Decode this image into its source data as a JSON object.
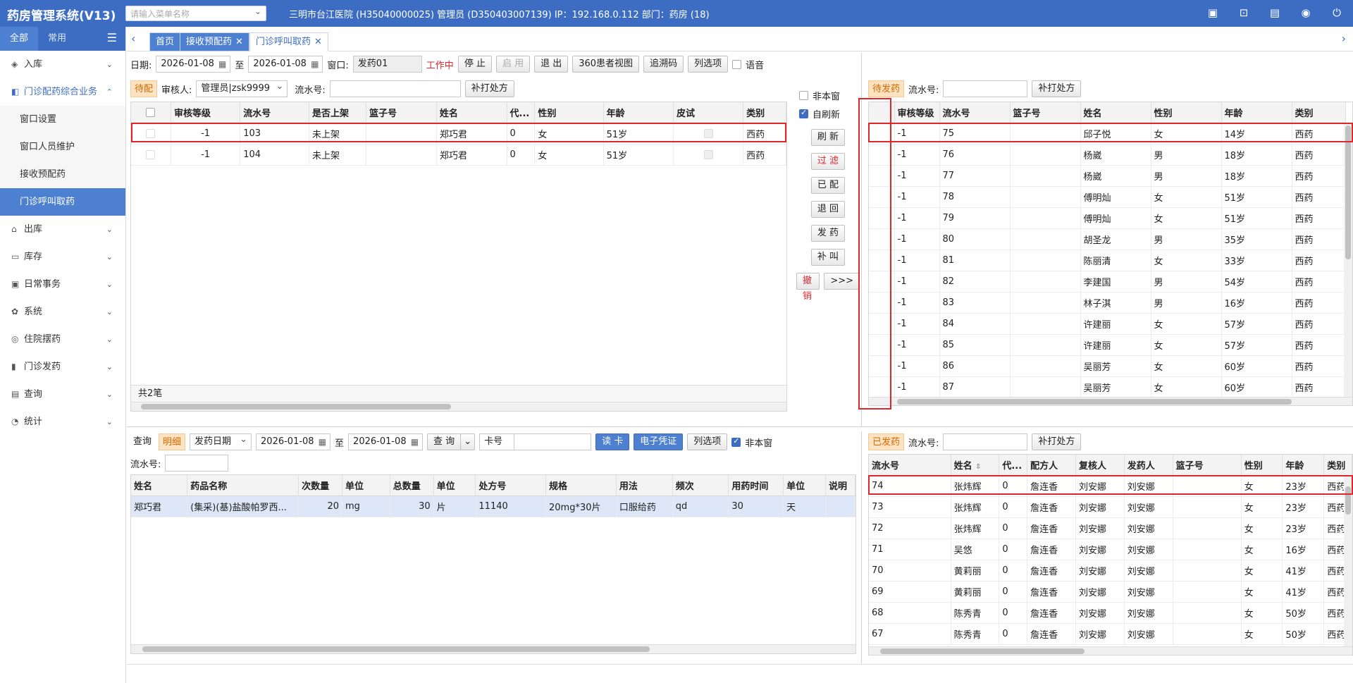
{
  "app": {
    "title": "药房管理系统(V13)",
    "menu_search_placeholder": "请输入菜单名称",
    "header_info": "三明市台江医院 (H35040000025) 管理员 (D350403007139) IP：192.168.0.112 部门：药房 (18)"
  },
  "sidebar": {
    "tab_all": "全部",
    "tab_common": "常用",
    "items": [
      {
        "label": "入库",
        "icon": "box-icon"
      },
      {
        "label": "门诊配药综合业务",
        "icon": "bag-icon"
      },
      {
        "label": "出库",
        "icon": "home-icon"
      },
      {
        "label": "库存",
        "icon": "stock-icon"
      },
      {
        "label": "日常事务",
        "icon": "calendar-icon"
      },
      {
        "label": "系统",
        "icon": "gear-icon"
      },
      {
        "label": "住院摆药",
        "icon": "search-icon"
      },
      {
        "label": "门诊发药",
        "icon": "pill-icon"
      },
      {
        "label": "查询",
        "icon": "query-icon"
      },
      {
        "label": "统计",
        "icon": "chart-icon"
      }
    ],
    "subitems": [
      "窗口设置",
      "窗口人员维护",
      "接收预配药",
      "门诊呼叫取药"
    ]
  },
  "tabs": {
    "home": "首页",
    "receive": "接收预配药",
    "call": "门诊呼叫取药"
  },
  "toolbar": {
    "date_label": "日期:",
    "date_from": "2026-01-08",
    "to_label": "至",
    "date_to": "2026-01-08",
    "window_label": "窗口:",
    "window_value": "发药01",
    "status": "工作中",
    "stop": "停 止",
    "enable": "启 用",
    "exit": "退 出",
    "view360": "360患者视图",
    "trace": "追溯码",
    "columns": "列选项",
    "voice": "语音"
  },
  "left_panel": {
    "tag": "待配",
    "reviewer_label": "审核人:",
    "reviewer_value": "管理员|zsk9999",
    "serial_label": "流水号:",
    "reprint": "补打处方",
    "headers": [
      "审核等级",
      "流水号",
      "是否上架",
      "篮子号",
      "姓名",
      "代...",
      "性别",
      "年龄",
      "皮试",
      "类别"
    ],
    "rows": [
      [
        "-1",
        "103",
        "未上架",
        "",
        "郑巧君",
        "0",
        "女",
        "51岁",
        "",
        "西药"
      ],
      [
        "-1",
        "104",
        "未上架",
        "",
        "郑巧君",
        "0",
        "女",
        "51岁",
        "",
        "西药"
      ]
    ],
    "total": "共2笔"
  },
  "middle": {
    "non_window": "非本窗",
    "auto_refresh": "自刷新",
    "refresh": "刷 新",
    "filter": "过 滤",
    "matched": "已 配",
    "return": "退 回",
    "dispense": "发 药",
    "recall": "补 叫",
    "cancel": "撤 销",
    "more": ">>>"
  },
  "right_top": {
    "tag": "待发药",
    "serial_label": "流水号:",
    "reprint": "补打处方",
    "headers": [
      "审核等级",
      "流水号",
      "篮子号",
      "姓名",
      "性别",
      "年龄",
      "类别"
    ],
    "rows": [
      [
        "-1",
        "75",
        "",
        "邱子悦",
        "女",
        "14岁",
        "西药"
      ],
      [
        "-1",
        "76",
        "",
        "杨崴",
        "男",
        "18岁",
        "西药"
      ],
      [
        "-1",
        "77",
        "",
        "杨崴",
        "男",
        "18岁",
        "西药"
      ],
      [
        "-1",
        "78",
        "",
        "傅明灿",
        "女",
        "51岁",
        "西药"
      ],
      [
        "-1",
        "79",
        "",
        "傅明灿",
        "女",
        "51岁",
        "西药"
      ],
      [
        "-1",
        "80",
        "",
        "胡圣龙",
        "男",
        "35岁",
        "西药"
      ],
      [
        "-1",
        "81",
        "",
        "陈丽清",
        "女",
        "33岁",
        "西药"
      ],
      [
        "-1",
        "82",
        "",
        "李建国",
        "男",
        "54岁",
        "西药"
      ],
      [
        "-1",
        "83",
        "",
        "林子淇",
        "男",
        "16岁",
        "西药"
      ],
      [
        "-1",
        "84",
        "",
        "许建丽",
        "女",
        "57岁",
        "西药"
      ],
      [
        "-1",
        "85",
        "",
        "许建丽",
        "女",
        "57岁",
        "西药"
      ],
      [
        "-1",
        "86",
        "",
        "吴丽芳",
        "女",
        "60岁",
        "西药"
      ],
      [
        "-1",
        "87",
        "",
        "吴丽芳",
        "女",
        "60岁",
        "西药"
      ]
    ]
  },
  "bottom_left": {
    "query": "查询",
    "detail_tag": "明细",
    "date_type": "发药日期",
    "date_from": "2026-01-08",
    "to_label": "至",
    "date_to": "2026-01-08",
    "query_btn": "查 询",
    "card_label": "卡号",
    "read_card": "读 卡",
    "e_voucher": "电子凭证",
    "columns": "列选项",
    "non_window": "非本窗",
    "serial_label": "流水号:",
    "headers": [
      "姓名",
      "药品名称",
      "次数量",
      "单位",
      "总数量",
      "单位",
      "处方号",
      "规格",
      "用法",
      "频次",
      "用药时间",
      "单位",
      "说明"
    ],
    "rows": [
      [
        "郑巧君",
        "(集采)(基)盐酸帕罗西...",
        "20",
        "mg",
        "30",
        "片",
        "11140",
        "20mg*30片",
        "口服给药",
        "qd",
        "30",
        "天",
        ""
      ]
    ]
  },
  "bottom_right": {
    "tag": "已发药",
    "serial_label": "流水号:",
    "reprint": "补打处方",
    "headers": [
      "流水号",
      "姓名",
      "代...",
      "配方人",
      "复核人",
      "发药人",
      "篮子号",
      "性别",
      "年龄",
      "类别"
    ],
    "rows": [
      [
        "74",
        "张炜辉",
        "0",
        "詹连香",
        "刘安娜",
        "刘安娜",
        "",
        "女",
        "23岁",
        "西药"
      ],
      [
        "73",
        "张炜辉",
        "0",
        "詹连香",
        "刘安娜",
        "刘安娜",
        "",
        "女",
        "23岁",
        "西药"
      ],
      [
        "72",
        "张炜辉",
        "0",
        "詹连香",
        "刘安娜",
        "刘安娜",
        "",
        "女",
        "23岁",
        "西药"
      ],
      [
        "71",
        "吴悠",
        "0",
        "詹连香",
        "刘安娜",
        "刘安娜",
        "",
        "女",
        "16岁",
        "西药"
      ],
      [
        "70",
        "黄莉丽",
        "0",
        "詹连香",
        "刘安娜",
        "刘安娜",
        "",
        "女",
        "41岁",
        "西药"
      ],
      [
        "69",
        "黄莉丽",
        "0",
        "詹连香",
        "刘安娜",
        "刘安娜",
        "",
        "女",
        "41岁",
        "西药"
      ],
      [
        "68",
        "陈秀青",
        "0",
        "詹连香",
        "刘安娜",
        "刘安娜",
        "",
        "女",
        "50岁",
        "西药"
      ],
      [
        "67",
        "陈秀青",
        "0",
        "詹连香",
        "刘安娜",
        "刘安娜",
        "",
        "女",
        "50岁",
        "西药"
      ]
    ]
  },
  "colors": {
    "primary": "#3d6dc2",
    "highlight_red": "#e0262c",
    "tag_orange": "#d26a00"
  }
}
